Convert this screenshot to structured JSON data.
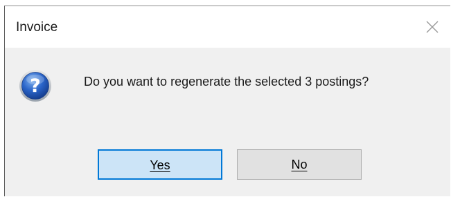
{
  "window": {
    "title": "Invoice"
  },
  "message": {
    "text": "Do you want to regenerate the selected 3 postings?",
    "icon": "question-icon"
  },
  "buttons": {
    "yes_label": "Yes",
    "no_label": "No"
  },
  "colors": {
    "default_button_border": "#0078d7",
    "default_button_fill": "#cce4f7",
    "button_fill": "#e1e1e1",
    "dialog_background": "#f0f0f0"
  }
}
